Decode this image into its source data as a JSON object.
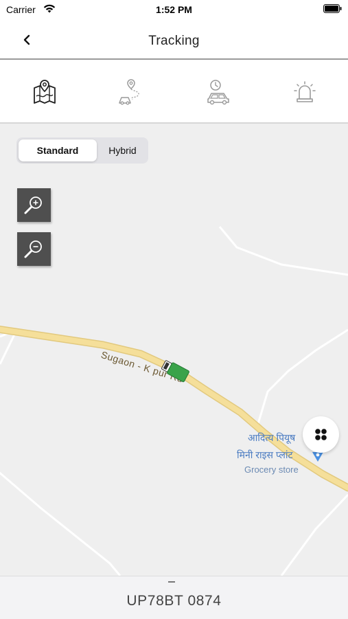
{
  "status_bar": {
    "carrier": "Carrier",
    "time": "1:52 PM"
  },
  "nav": {
    "title": "Tracking",
    "back_icon": "chevron-left-icon"
  },
  "tabs": [
    {
      "icon": "map-location-icon",
      "active": true
    },
    {
      "icon": "route-car-icon",
      "active": false
    },
    {
      "icon": "car-history-icon",
      "active": false
    },
    {
      "icon": "alarm-bell-icon",
      "active": false
    }
  ],
  "map_type": {
    "options": [
      "Standard",
      "Hybrid"
    ],
    "selected": "Standard"
  },
  "zoom": {
    "in_icon": "zoom-in-icon",
    "out_icon": "zoom-out-icon"
  },
  "map": {
    "road_label": "Sugaon - K      pur Rd",
    "poi": {
      "name_line1": "आदित्य पियूष",
      "name_line2": "मिनी राइस प्लांट",
      "category": "Grocery store",
      "pin_color": "#4a90e2"
    },
    "vehicle_color": "#3aa34a"
  },
  "fab_icon": "grid-menu-icon",
  "vehicle": {
    "plate": "UP78BT 0874"
  },
  "colors": {
    "map_bg": "#efefef",
    "road_main": "#f5df9a",
    "road_minor": "#ffffff",
    "zoom_btn": "#4f4f4f"
  }
}
